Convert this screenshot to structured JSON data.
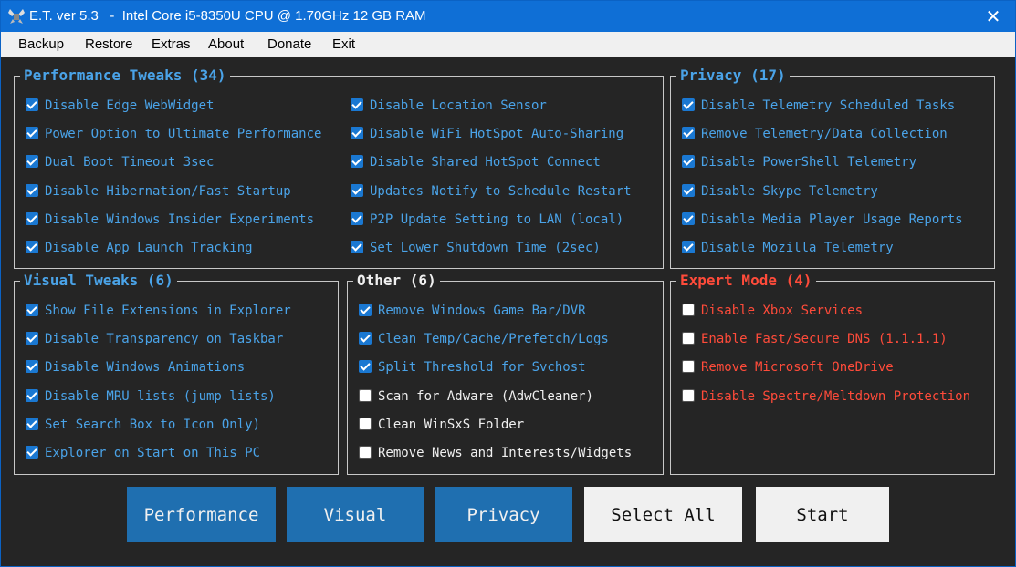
{
  "window": {
    "title": "E.T. ver 5.3   -  Intel Core i5-8350U CPU @ 1.70GHz 12 GB RAM"
  },
  "menu": [
    "Backup",
    "Restore",
    "Extras",
    "About",
    "Donate",
    "Exit"
  ],
  "groups": {
    "performance": {
      "title": "Performance Tweaks (34)",
      "items": [
        {
          "label": "Disable Edge WebWidget",
          "checked": true
        },
        {
          "label": "Power Option to Ultimate Performance",
          "checked": true
        },
        {
          "label": "Dual Boot Timeout 3sec",
          "checked": true
        },
        {
          "label": "Disable Hibernation/Fast Startup",
          "checked": true
        },
        {
          "label": "Disable Windows Insider Experiments",
          "checked": true
        },
        {
          "label": "Disable App Launch Tracking",
          "checked": true
        },
        {
          "label": "Disable Location Sensor",
          "checked": true
        },
        {
          "label": "Disable WiFi HotSpot Auto-Sharing",
          "checked": true
        },
        {
          "label": "Disable Shared HotSpot Connect",
          "checked": true
        },
        {
          "label": "Updates Notify to Schedule Restart",
          "checked": true
        },
        {
          "label": "P2P Update Setting to LAN (local)",
          "checked": true
        },
        {
          "label": "Set Lower Shutdown Time (2sec)",
          "checked": true
        }
      ]
    },
    "privacy": {
      "title": "Privacy (17)",
      "items": [
        {
          "label": "Disable Telemetry Scheduled Tasks",
          "checked": true
        },
        {
          "label": "Remove Telemetry/Data Collection",
          "checked": true
        },
        {
          "label": "Disable PowerShell Telemetry",
          "checked": true
        },
        {
          "label": "Disable Skype Telemetry",
          "checked": true
        },
        {
          "label": "Disable Media Player Usage Reports",
          "checked": true
        },
        {
          "label": "Disable Mozilla Telemetry",
          "checked": true
        }
      ]
    },
    "visual": {
      "title": "Visual Tweaks (6)",
      "items": [
        {
          "label": "Show File Extensions in Explorer",
          "checked": true
        },
        {
          "label": "Disable Transparency on Taskbar",
          "checked": true
        },
        {
          "label": "Disable Windows Animations",
          "checked": true
        },
        {
          "label": "Disable MRU lists (jump lists)",
          "checked": true
        },
        {
          "label": "Set Search Box to Icon Only)",
          "checked": true
        },
        {
          "label": "Explorer on Start on This PC",
          "checked": true
        }
      ]
    },
    "other": {
      "title": "Other (6)",
      "items": [
        {
          "label": "Remove Windows Game Bar/DVR",
          "checked": true
        },
        {
          "label": "Clean Temp/Cache/Prefetch/Logs",
          "checked": true
        },
        {
          "label": "Split Threshold for Svchost",
          "checked": true
        },
        {
          "label": "Scan for Adware (AdwCleaner)",
          "checked": false
        },
        {
          "label": "Clean WinSxS Folder",
          "checked": false
        },
        {
          "label": "Remove News and Interests/Widgets",
          "checked": false
        }
      ]
    },
    "expert": {
      "title": "Expert Mode (4)",
      "items": [
        {
          "label": "Disable Xbox Services",
          "checked": false
        },
        {
          "label": "Enable Fast/Secure DNS (1.1.1.1)",
          "checked": false
        },
        {
          "label": "Remove Microsoft OneDrive",
          "checked": false
        },
        {
          "label": "Disable Spectre/Meltdown Protection",
          "checked": false
        }
      ]
    }
  },
  "buttons": {
    "performance": "Performance",
    "visual": "Visual",
    "privacy": "Privacy",
    "select_all": "Select All",
    "start": "Start"
  },
  "colors": {
    "accent": "#0f6fd6",
    "background": "#252525",
    "label_blue": "#4aa3e8",
    "label_red": "#ff4b3a",
    "checkbox_checked": "#1a78d2",
    "button_blue": "#1f6fb0"
  },
  "icons": {
    "app": "app-icon",
    "close": "close-icon"
  }
}
